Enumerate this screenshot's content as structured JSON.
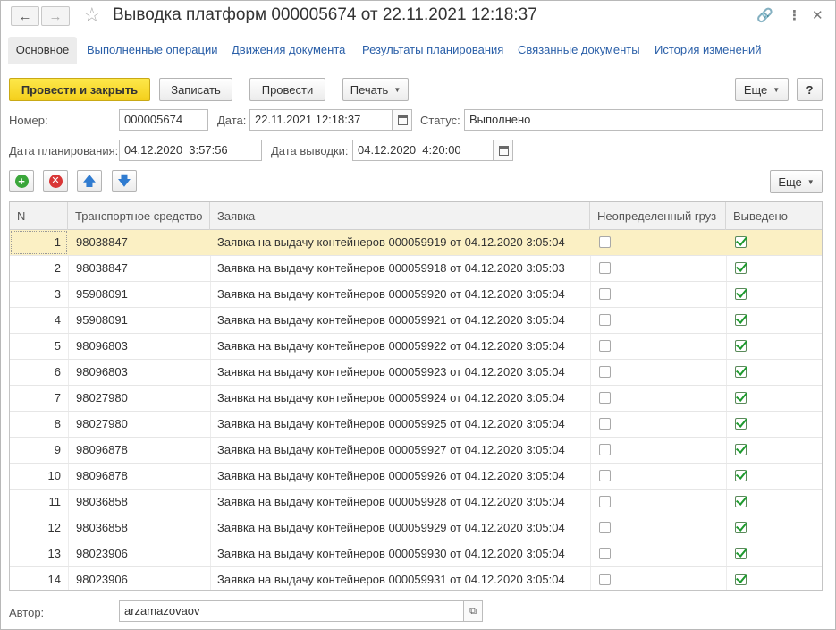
{
  "window": {
    "title": "Выводка платформ 000005674 от 22.11.2021 12:18:37"
  },
  "icons": {
    "back": "arrow-left-icon",
    "forward": "arrow-right-icon",
    "favorite": "star-icon",
    "link": "link-icon",
    "more": "more-vertical-icon",
    "close": "close-icon"
  },
  "tabs": [
    {
      "label": "Основное",
      "active": true
    },
    {
      "label": "Выполненные операции"
    },
    {
      "label": "Движения документа"
    },
    {
      "label": "Результаты планирования"
    },
    {
      "label": "Связанные документы"
    },
    {
      "label": "История изменений"
    }
  ],
  "toolbar": {
    "post_close": "Провести и закрыть",
    "save": "Записать",
    "post": "Провести",
    "print": "Печать",
    "more": "Еще",
    "help": "?"
  },
  "form": {
    "number_label": "Номер:",
    "number": "000005674",
    "date_label": "Дата:",
    "date": "22.11.2021 12:18:37",
    "status_label": "Статус:",
    "status": "Выполнено",
    "plan_date_label": "Дата планирования:",
    "plan_date": "04.12.2020  3:57:56",
    "out_date_label": "Дата выводки:",
    "out_date": "04.12.2020  4:20:00"
  },
  "table_toolbar": {
    "more": "Еще"
  },
  "table": {
    "columns": [
      "N",
      "Транспортное средство",
      "Заявка",
      "Неопределенный груз",
      "Выведено"
    ],
    "rows": [
      {
        "n": "1",
        "vehicle": "98038847",
        "request": "Заявка на выдачу контейнеров 000059919 от 04.12.2020 3:05:04",
        "undefined_cargo": false,
        "done": true
      },
      {
        "n": "2",
        "vehicle": "98038847",
        "request": "Заявка на выдачу контейнеров 000059918 от 04.12.2020 3:05:03",
        "undefined_cargo": false,
        "done": true
      },
      {
        "n": "3",
        "vehicle": "95908091",
        "request": "Заявка на выдачу контейнеров 000059920 от 04.12.2020 3:05:04",
        "undefined_cargo": false,
        "done": true
      },
      {
        "n": "4",
        "vehicle": "95908091",
        "request": "Заявка на выдачу контейнеров 000059921 от 04.12.2020 3:05:04",
        "undefined_cargo": false,
        "done": true
      },
      {
        "n": "5",
        "vehicle": "98096803",
        "request": "Заявка на выдачу контейнеров 000059922 от 04.12.2020 3:05:04",
        "undefined_cargo": false,
        "done": true
      },
      {
        "n": "6",
        "vehicle": "98096803",
        "request": "Заявка на выдачу контейнеров 000059923 от 04.12.2020 3:05:04",
        "undefined_cargo": false,
        "done": true
      },
      {
        "n": "7",
        "vehicle": "98027980",
        "request": "Заявка на выдачу контейнеров 000059924 от 04.12.2020 3:05:04",
        "undefined_cargo": false,
        "done": true
      },
      {
        "n": "8",
        "vehicle": "98027980",
        "request": "Заявка на выдачу контейнеров 000059925 от 04.12.2020 3:05:04",
        "undefined_cargo": false,
        "done": true
      },
      {
        "n": "9",
        "vehicle": "98096878",
        "request": "Заявка на выдачу контейнеров 000059927 от 04.12.2020 3:05:04",
        "undefined_cargo": false,
        "done": true
      },
      {
        "n": "10",
        "vehicle": "98096878",
        "request": "Заявка на выдачу контейнеров 000059926 от 04.12.2020 3:05:04",
        "undefined_cargo": false,
        "done": true
      },
      {
        "n": "11",
        "vehicle": "98036858",
        "request": "Заявка на выдачу контейнеров 000059928 от 04.12.2020 3:05:04",
        "undefined_cargo": false,
        "done": true
      },
      {
        "n": "12",
        "vehicle": "98036858",
        "request": "Заявка на выдачу контейнеров 000059929 от 04.12.2020 3:05:04",
        "undefined_cargo": false,
        "done": true
      },
      {
        "n": "13",
        "vehicle": "98023906",
        "request": "Заявка на выдачу контейнеров 000059930 от 04.12.2020 3:05:04",
        "undefined_cargo": false,
        "done": true
      },
      {
        "n": "14",
        "vehicle": "98023906",
        "request": "Заявка на выдачу контейнеров 000059931 от 04.12.2020 3:05:04",
        "undefined_cargo": false,
        "done": true
      }
    ]
  },
  "footer": {
    "author_label": "Автор:",
    "author": "arzamazovaov"
  },
  "colors": {
    "primary_button": "#f4cf1c",
    "selected_row": "#fbf0c4",
    "link": "#2a5fa8",
    "check": "#1e9a2e"
  }
}
